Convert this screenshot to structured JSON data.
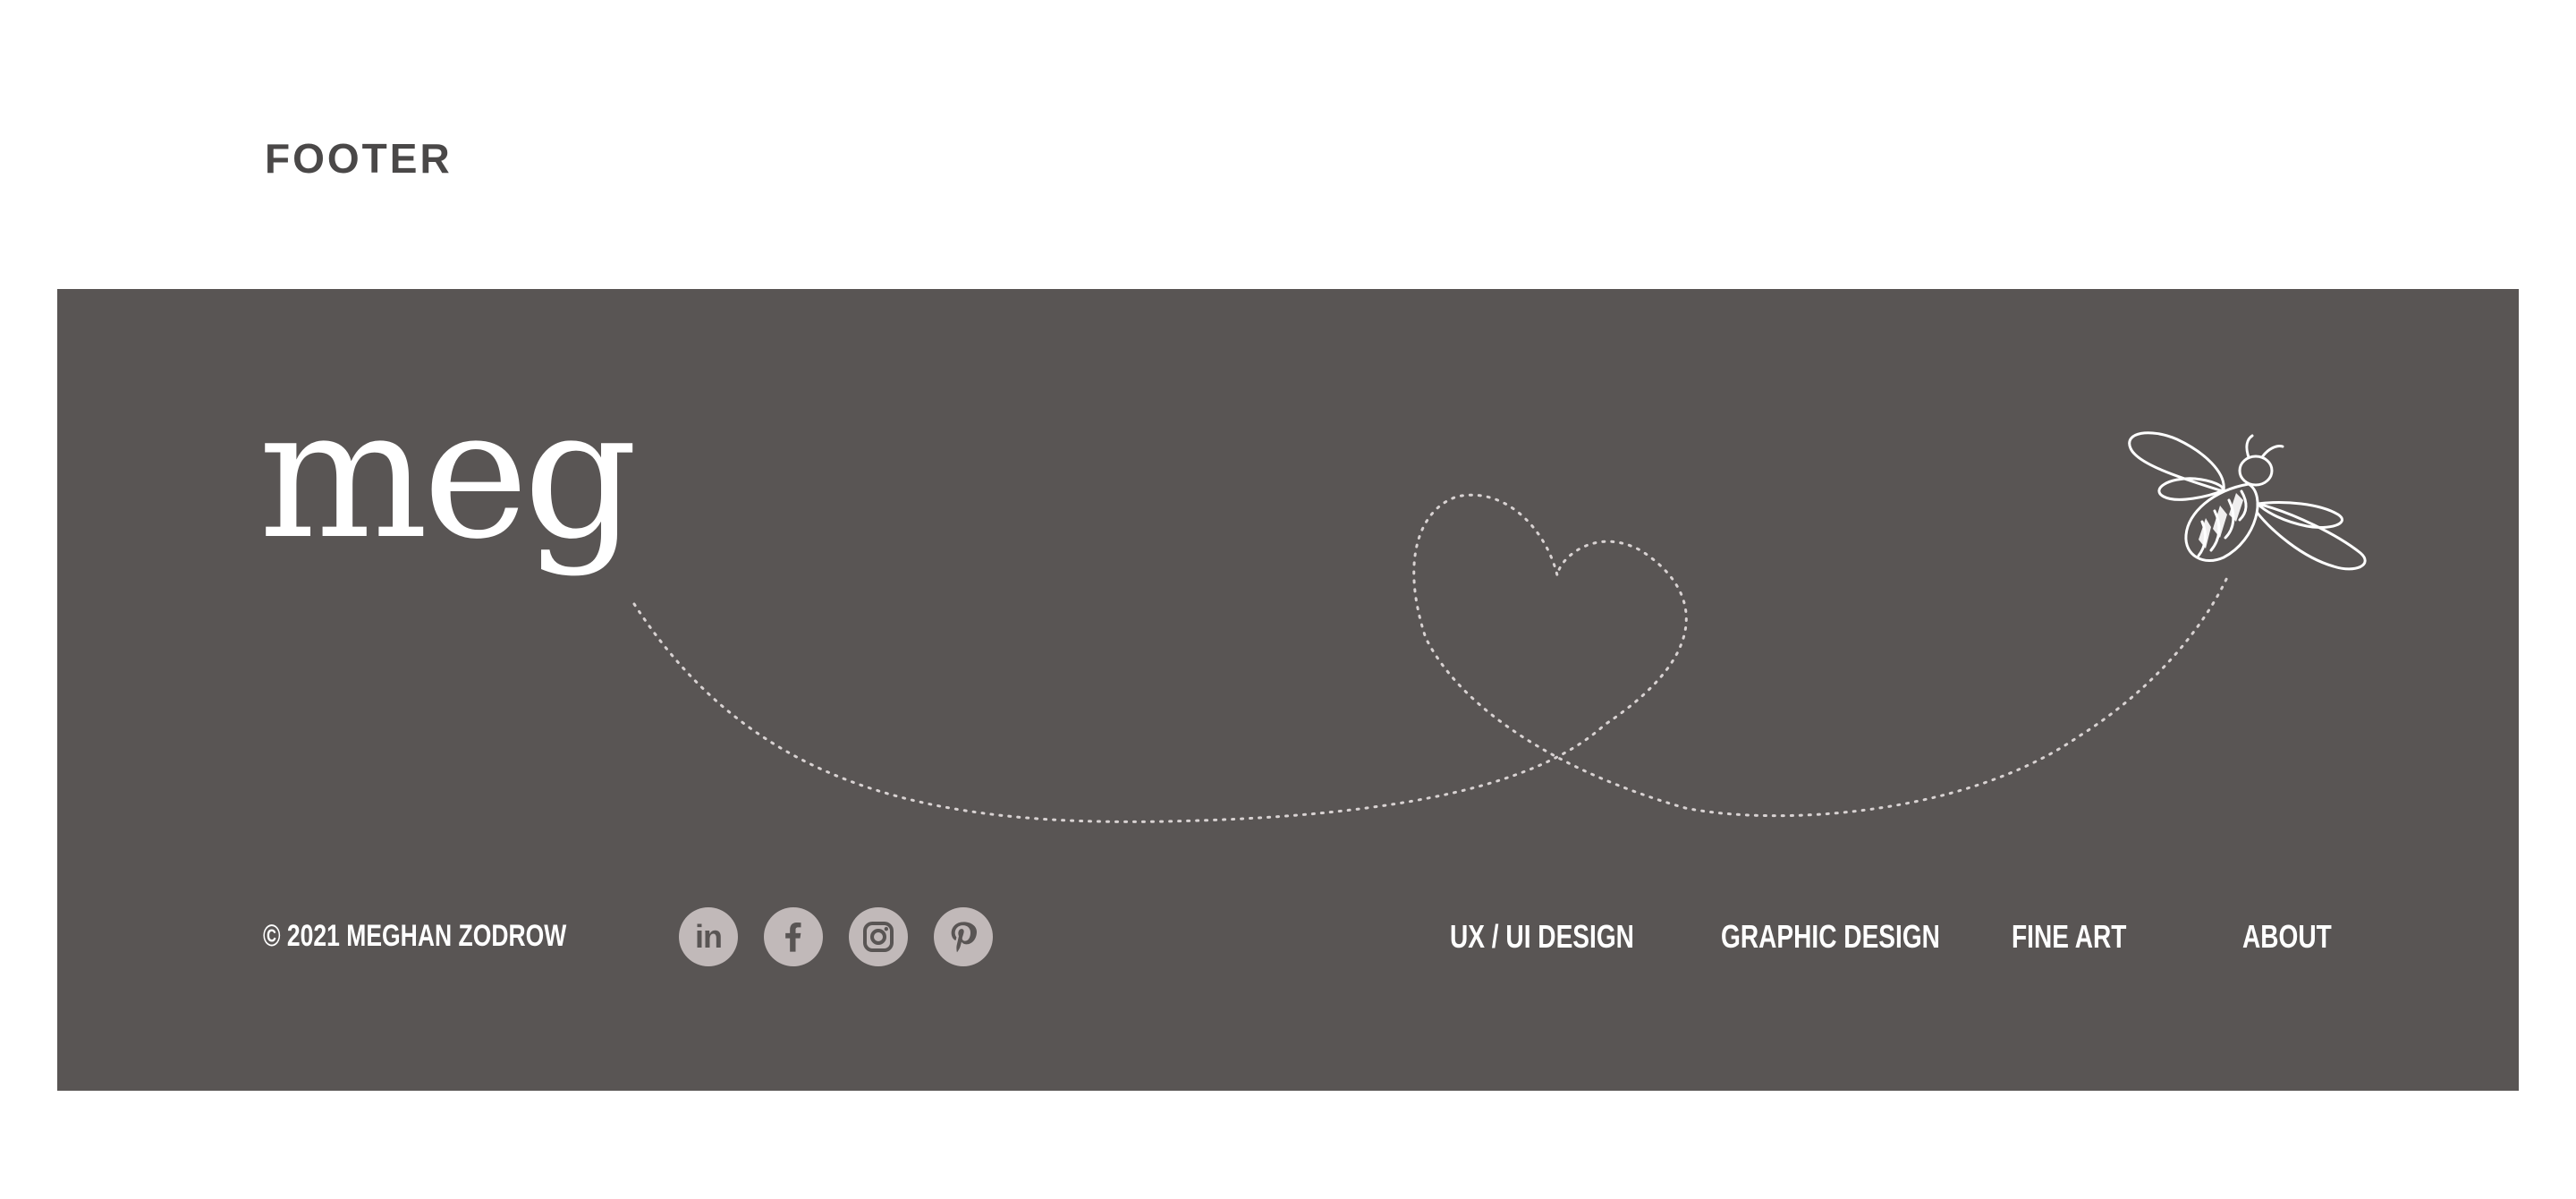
{
  "section_label": "FOOTER",
  "colors": {
    "footer_background": "#595554",
    "text": "#ffffff",
    "social_icon_background": "#c1b9b9",
    "heading": "#4a4848"
  },
  "footer": {
    "logo_text": "meg",
    "decoration": "bee-icon",
    "copyright": "© 2021 MEGHAN ZODROW",
    "social": [
      {
        "name": "LinkedIn",
        "icon": "linkedin-icon",
        "glyph": "in"
      },
      {
        "name": "Facebook",
        "icon": "facebook-icon"
      },
      {
        "name": "Instagram",
        "icon": "instagram-icon"
      },
      {
        "name": "Pinterest",
        "icon": "pinterest-icon"
      }
    ],
    "nav": [
      {
        "label": "UX / UI DESIGN"
      },
      {
        "label": "GRAPHIC DESIGN"
      },
      {
        "label": "FINE ART"
      },
      {
        "label": "ABOUT"
      }
    ]
  }
}
